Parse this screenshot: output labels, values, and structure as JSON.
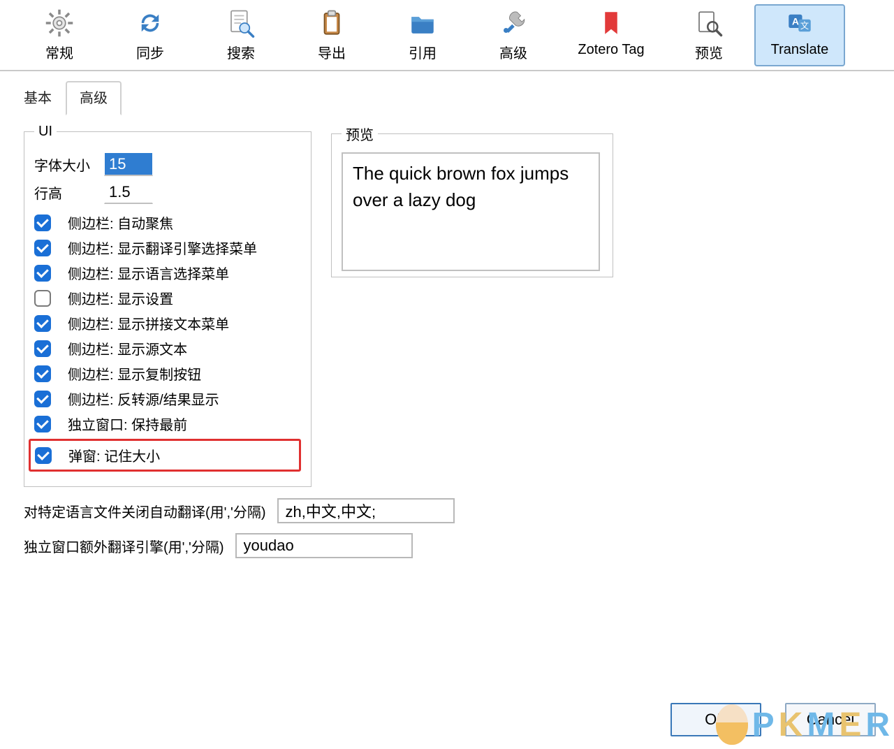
{
  "toolbar": {
    "items": [
      {
        "id": "general",
        "label": "常规",
        "icon": "gear-icon"
      },
      {
        "id": "sync",
        "label": "同步",
        "icon": "sync-icon"
      },
      {
        "id": "search",
        "label": "搜索",
        "icon": "search-doc-icon"
      },
      {
        "id": "export",
        "label": "导出",
        "icon": "clipboard-icon"
      },
      {
        "id": "cite",
        "label": "引用",
        "icon": "folder-icon"
      },
      {
        "id": "advanced",
        "label": "高级",
        "icon": "tools-icon"
      },
      {
        "id": "zoterotag",
        "label": "Zotero Tag",
        "icon": "bookmark-icon"
      },
      {
        "id": "preview",
        "label": "预览",
        "icon": "page-mag-icon"
      },
      {
        "id": "translate",
        "label": "Translate",
        "icon": "translate-icon",
        "active": true
      }
    ]
  },
  "subtabs": {
    "basic": "基本",
    "advanced": "高级",
    "active": "advanced"
  },
  "ui": {
    "legend": "UI",
    "font_size_label": "字体大小",
    "font_size_value": "15",
    "line_height_label": "行高",
    "line_height_value": "1.5",
    "checks": [
      {
        "label": "侧边栏: 自动聚焦",
        "checked": true
      },
      {
        "label": "侧边栏: 显示翻译引擎选择菜单",
        "checked": true
      },
      {
        "label": "侧边栏: 显示语言选择菜单",
        "checked": true
      },
      {
        "label": "侧边栏: 显示设置",
        "checked": false
      },
      {
        "label": "侧边栏: 显示拼接文本菜单",
        "checked": true
      },
      {
        "label": "侧边栏: 显示源文本",
        "checked": true
      },
      {
        "label": "侧边栏: 显示复制按钮",
        "checked": true
      },
      {
        "label": "侧边栏: 反转源/结果显示",
        "checked": true
      },
      {
        "label": "独立窗口: 保持最前",
        "checked": true
      },
      {
        "label": "弹窗: 记住大小",
        "checked": true,
        "highlight": true
      }
    ]
  },
  "preview": {
    "legend": "预览",
    "text": "The quick brown fox jumps over a lazy dog"
  },
  "footer": {
    "disable_lang_label": "对特定语言文件关闭自动翻译(用','分隔)",
    "disable_lang_value": "zh,中文,中文;",
    "extra_engine_label": "独立窗口额外翻译引擎(用','分隔)",
    "extra_engine_value": "youdao"
  },
  "buttons": {
    "ok": "OK",
    "cancel": "Cancel"
  },
  "watermark": "PKMER"
}
